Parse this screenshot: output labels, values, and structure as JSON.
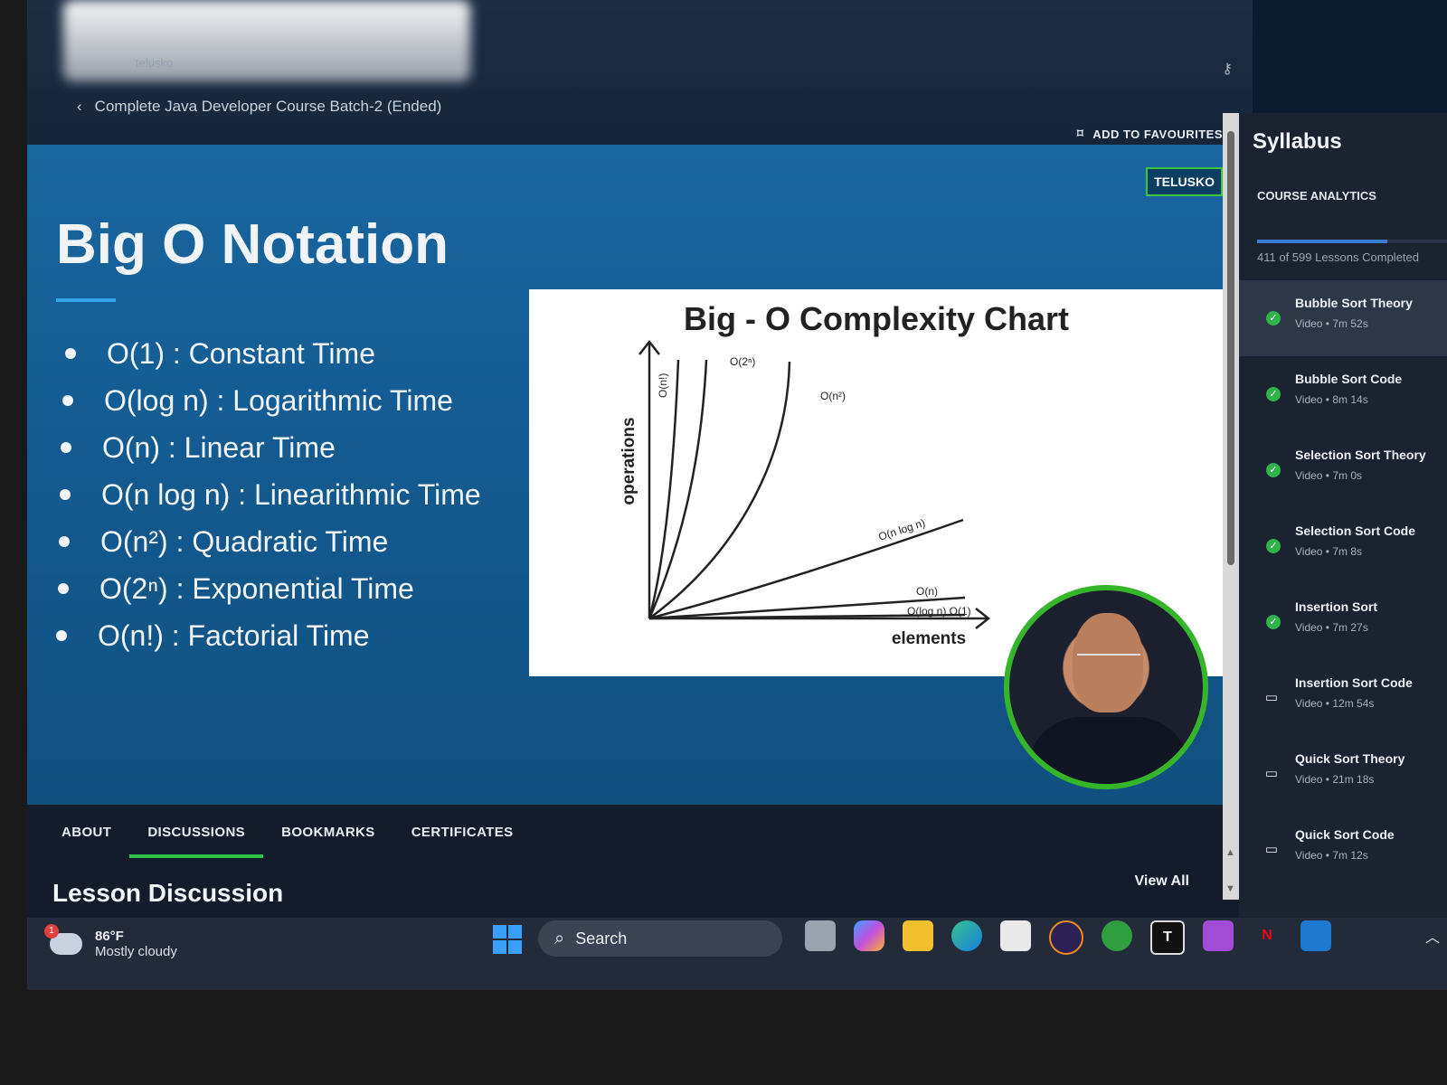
{
  "header": {
    "site_name": "telusko",
    "breadcrumb_course": "Complete Java Developer Course Batch-2 (Ended)",
    "add_to_favourites": "ADD TO FAVOURITES"
  },
  "slide": {
    "brand_badge": "TELUSKO",
    "title": "Big O Notation",
    "bullets": [
      "O(1) : Constant Time",
      "O(log n) : Logarithmic Time",
      "O(n) : Linear Time",
      "O(n log n) : Linearithmic Time",
      "O(n²) : Quadratic Time",
      "O(2ⁿ) : Exponential Time",
      "O(n!) : Factorial Time"
    ]
  },
  "chart_data": {
    "type": "line",
    "title": "Big - O Complexity Chart",
    "xlabel": "elements",
    "ylabel": "operations",
    "curve_labels": [
      "O(n!)",
      "O(2ⁿ)",
      "O(n²)",
      "O(n log n)",
      "O(n)",
      "O(log n),O(1)"
    ]
  },
  "tabs": {
    "items": [
      "ABOUT",
      "DISCUSSIONS",
      "BOOKMARKS",
      "CERTIFICATES"
    ],
    "active": "DISCUSSIONS"
  },
  "discussion": {
    "heading": "Lesson Discussion",
    "view_all": "View All"
  },
  "sidebar": {
    "title": "Syllabus",
    "analytics_label": "COURSE ANALYTICS",
    "progress_text": "411 of 599 Lessons Completed",
    "progress_fraction": 0.686,
    "lessons": [
      {
        "name": "Bubble Sort Theory",
        "meta": "Video • 7m 52s",
        "status": "done",
        "active": true
      },
      {
        "name": "Bubble Sort Code",
        "meta": "Video • 8m 14s",
        "status": "done",
        "active": false
      },
      {
        "name": "Selection Sort Theory",
        "meta": "Video • 7m 0s",
        "status": "done",
        "active": false
      },
      {
        "name": "Selection Sort Code",
        "meta": "Video • 7m 8s",
        "status": "done",
        "active": false
      },
      {
        "name": "Insertion Sort",
        "meta": "Video • 7m 27s",
        "status": "done",
        "active": false
      },
      {
        "name": "Insertion Sort Code",
        "meta": "Video • 12m 54s",
        "status": "video",
        "active": false
      },
      {
        "name": "Quick Sort Theory",
        "meta": "Video • 21m 18s",
        "status": "video",
        "active": false
      },
      {
        "name": "Quick Sort Code",
        "meta": "Video • 7m 12s",
        "status": "video",
        "active": false
      }
    ]
  },
  "taskbar": {
    "weather_temp": "86°F",
    "weather_condition": "Mostly cloudy",
    "weather_badge": "1",
    "search_label": "Search",
    "app_icons": [
      "task-view-icon",
      "copilot-icon",
      "file-explorer-icon",
      "edge-icon",
      "store-icon",
      "eclipse-icon",
      "xbox-icon",
      "typora-icon",
      "app-icon",
      "netflix-icon",
      "vscode-icon"
    ]
  },
  "colors": {
    "slide_bg": "#145c93",
    "accent_green": "#2fc24a",
    "progress_blue": "#3a7bd5"
  }
}
